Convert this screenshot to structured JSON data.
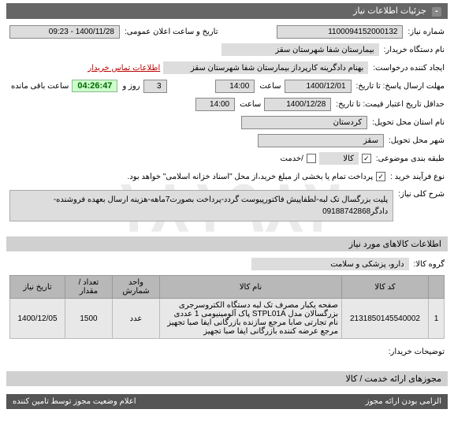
{
  "watermark": "۱۸۱۹۸۲",
  "section1": {
    "title": "جزئیات اطلاعات نیاز"
  },
  "form": {
    "reqno_label": "شماره نیاز:",
    "reqno": "1100094152000132",
    "announce_label": "تاریخ و ساعت اعلان عمومی:",
    "announce": "1400/11/28 - 09:23",
    "buyer_label": "نام دستگاه خریدار:",
    "buyer": "بیمارستان شفا شهرستان سقز",
    "creator_label": "ایجاد کننده درخواست:",
    "creator": "بهنام دادگرینه کارپرداز بیمارستان شفا شهرستان سقز",
    "contact_link": "اطلاعات تماس خریدار",
    "deadline_label": "مهلت ارسال پاسخ: تا تاریخ:",
    "deadline_date": "1400/12/01",
    "deadline_time_label": "ساعت",
    "deadline_time": "14:00",
    "days_label": "روز و",
    "days": "3",
    "remain_label": "ساعت باقی مانده",
    "remain": "04:26:47",
    "validity_label": "حداقل تاریخ اعتبار قیمت: تا تاریخ:",
    "validity_date": "1400/12/28",
    "validity_time": "14:00",
    "province_label": "نام استان محل تحویل:",
    "province": "کردستان",
    "city_label": "شهر محل تحویل:",
    "city": "سقز",
    "category_label": "طبقه بندی موضوعی:",
    "category": "کالا",
    "service_label": "/خدمت",
    "process_label": "نوع فرآیند خرید :",
    "process_text": "پرداخت تمام یا بخشی از مبلغ خرید،از محل \"اسناد خزانه اسلامی\" خواهد بود.",
    "checkbox_checked": true
  },
  "desc": {
    "label": "شرح کلی نیاز:",
    "text": "پلیت بزرگسال تک لبه-لطفاپیش فاکتورپیوست گردد-پرداخت بصورت7ماهه-هزینه ارسال بعهده فروشنده-دادگر09188742868"
  },
  "section2": {
    "title": "اطلاعات کالاهای مورد نیاز"
  },
  "group": {
    "label": "گروه کالا:",
    "value": "دارو، پزشکی و سلامت"
  },
  "table": {
    "headers": [
      "",
      "کد کالا",
      "نام کالا",
      "واحد شمارش",
      "تعداد / مقدار",
      "تاریخ نیاز"
    ],
    "rows": [
      {
        "idx": "1",
        "code": "2131850145540002",
        "name": "صفحه یکبار مصرف تک لبه دستگاه الکتروسرجری بزرگسالان مدل STPL01A پاک آلومینیومی 1 عددی نام تجارتی صابا مرجع سازنده بازرگانی ایفا صبا تجهیز مرجع عرضه کننده بازرگانی ایفا صبا تجهیز",
        "unit": "عدد",
        "qty": "1500",
        "date": "1400/12/05"
      }
    ]
  },
  "buyer_notes": {
    "label": "توضیحات خریدار:"
  },
  "section3": {
    "title": "مجوزهای ارائه خدمت / کالا"
  },
  "footer": {
    "right": "الزامی بودن ارائه مجوز",
    "left": "اعلام وضعیت مجوز توسط تامین کننده"
  }
}
